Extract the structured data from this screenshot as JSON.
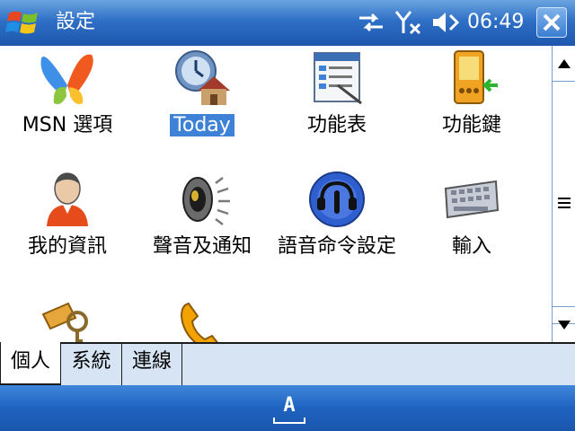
{
  "window": {
    "title": "設定",
    "time": "06:49"
  },
  "items": [
    {
      "label": "MSN 選項",
      "icon": "msn-butterfly-icon"
    },
    {
      "label": "Today",
      "icon": "today-clock-house-icon",
      "selected": true
    },
    {
      "label": "功能表",
      "icon": "menu-window-icon"
    },
    {
      "label": "功能鍵",
      "icon": "buttons-device-icon"
    },
    {
      "label": "我的資訊",
      "icon": "owner-info-person-icon"
    },
    {
      "label": "聲音及通知",
      "icon": "speaker-icon"
    },
    {
      "label": "語音命令設定",
      "icon": "voice-command-headset-icon"
    },
    {
      "label": "輸入",
      "icon": "keyboard-icon"
    },
    {
      "label": "",
      "icon": "keys-lock-icon"
    },
    {
      "label": "",
      "icon": "phone-icon"
    }
  ],
  "tabs": [
    {
      "label": "個人",
      "active": true
    },
    {
      "label": "系統",
      "active": false
    },
    {
      "label": "連線",
      "active": false
    }
  ],
  "sip_label": "A",
  "colors": {
    "title_bar": "#2f6fc6",
    "selection": "#3d82d7",
    "tab_bar": "#d6e4f3"
  }
}
